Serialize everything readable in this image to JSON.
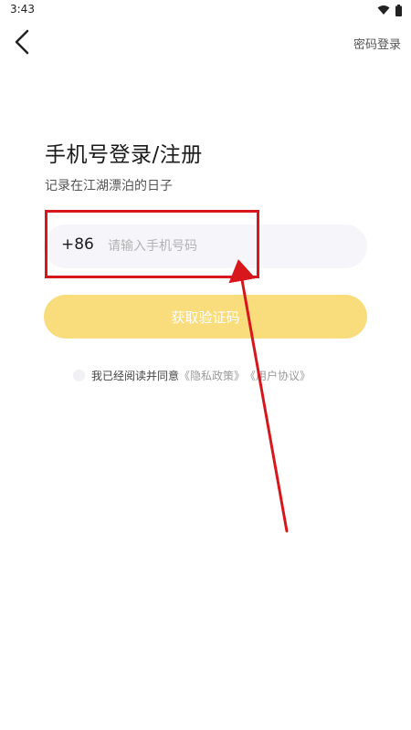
{
  "status_bar": {
    "time": "3:43",
    "icons": [
      "wifi-icon",
      "battery-icon"
    ]
  },
  "nav": {
    "back_icon": "chevron-left-icon",
    "password_login": "密码登录"
  },
  "main": {
    "title": "手机号登录/注册",
    "subtitle": "记录在江湖漂泊的日子"
  },
  "phone": {
    "country_code": "+86",
    "value": "",
    "placeholder": "请输入手机号码"
  },
  "get_code": {
    "label": "获取验证码"
  },
  "agreement": {
    "text": "我已经阅读并同意",
    "privacy_link": "《隐私政策》",
    "terms_link": "《用户协议》"
  },
  "colors": {
    "accent": "#f9dc7c",
    "field_bg": "#f6f6fa",
    "annotation": "#d8171d"
  }
}
